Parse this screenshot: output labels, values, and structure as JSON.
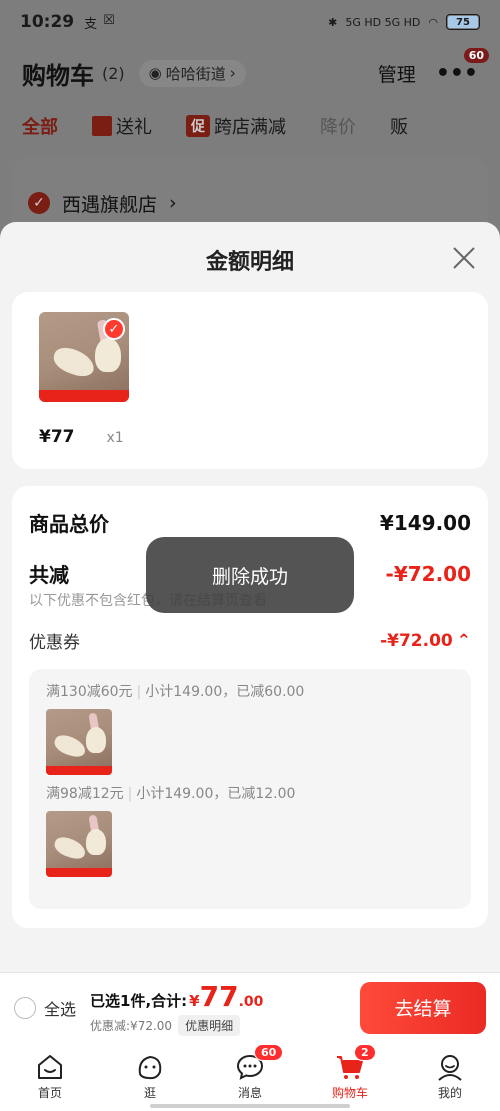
{
  "status_bar": {
    "time": "10:29",
    "app_icons": [
      "支",
      "☒"
    ],
    "signal": "5G HD 5G HD",
    "battery": "75"
  },
  "background_page": {
    "title": "购物车",
    "count": "(2)",
    "street": "哈哈街道",
    "manage": "管理",
    "more_badge": "60",
    "tabs": [
      "全部",
      "送礼",
      "跨店满减",
      "降价",
      "贩"
    ],
    "promo_tag": "促",
    "shop_name": "西遇旗舰店"
  },
  "sheet": {
    "title": "金额明细",
    "product": {
      "price": "¥77",
      "qty": "x1"
    },
    "summary": {
      "total_label": "商品总价",
      "total_value": "¥149.00",
      "reduce_label": "共减",
      "reduce_value": "-¥72.00",
      "reduce_note": "以下优惠不包含红包，请在结算页查看",
      "coupon_label": "优惠券",
      "coupon_value": "-¥72.00",
      "coupons": [
        {
          "rule": "满130减60元",
          "detail": "小计149.00，已减60.00"
        },
        {
          "rule": "满98减12元",
          "detail": "小计149.00，已减12.00"
        }
      ]
    }
  },
  "toast": "删除成功",
  "checkout": {
    "select_all": "全选",
    "selected_text": "已选1件,合计:",
    "currency": "¥",
    "total_int": "77",
    "total_dec": ".00",
    "discount_text": "优惠减:¥72.00",
    "detail_button": "优惠明细",
    "checkout_button": "去结算"
  },
  "tabbar": {
    "items": [
      {
        "label": "首页",
        "icon": "home-icon"
      },
      {
        "label": "逛",
        "icon": "browse-icon"
      },
      {
        "label": "消息",
        "icon": "message-icon",
        "badge": "60"
      },
      {
        "label": "购物车",
        "icon": "cart-icon",
        "badge": "2"
      },
      {
        "label": "我的",
        "icon": "profile-icon"
      }
    ]
  },
  "colors": {
    "accent": "#e8231a",
    "badge": "#ff2d2d"
  }
}
